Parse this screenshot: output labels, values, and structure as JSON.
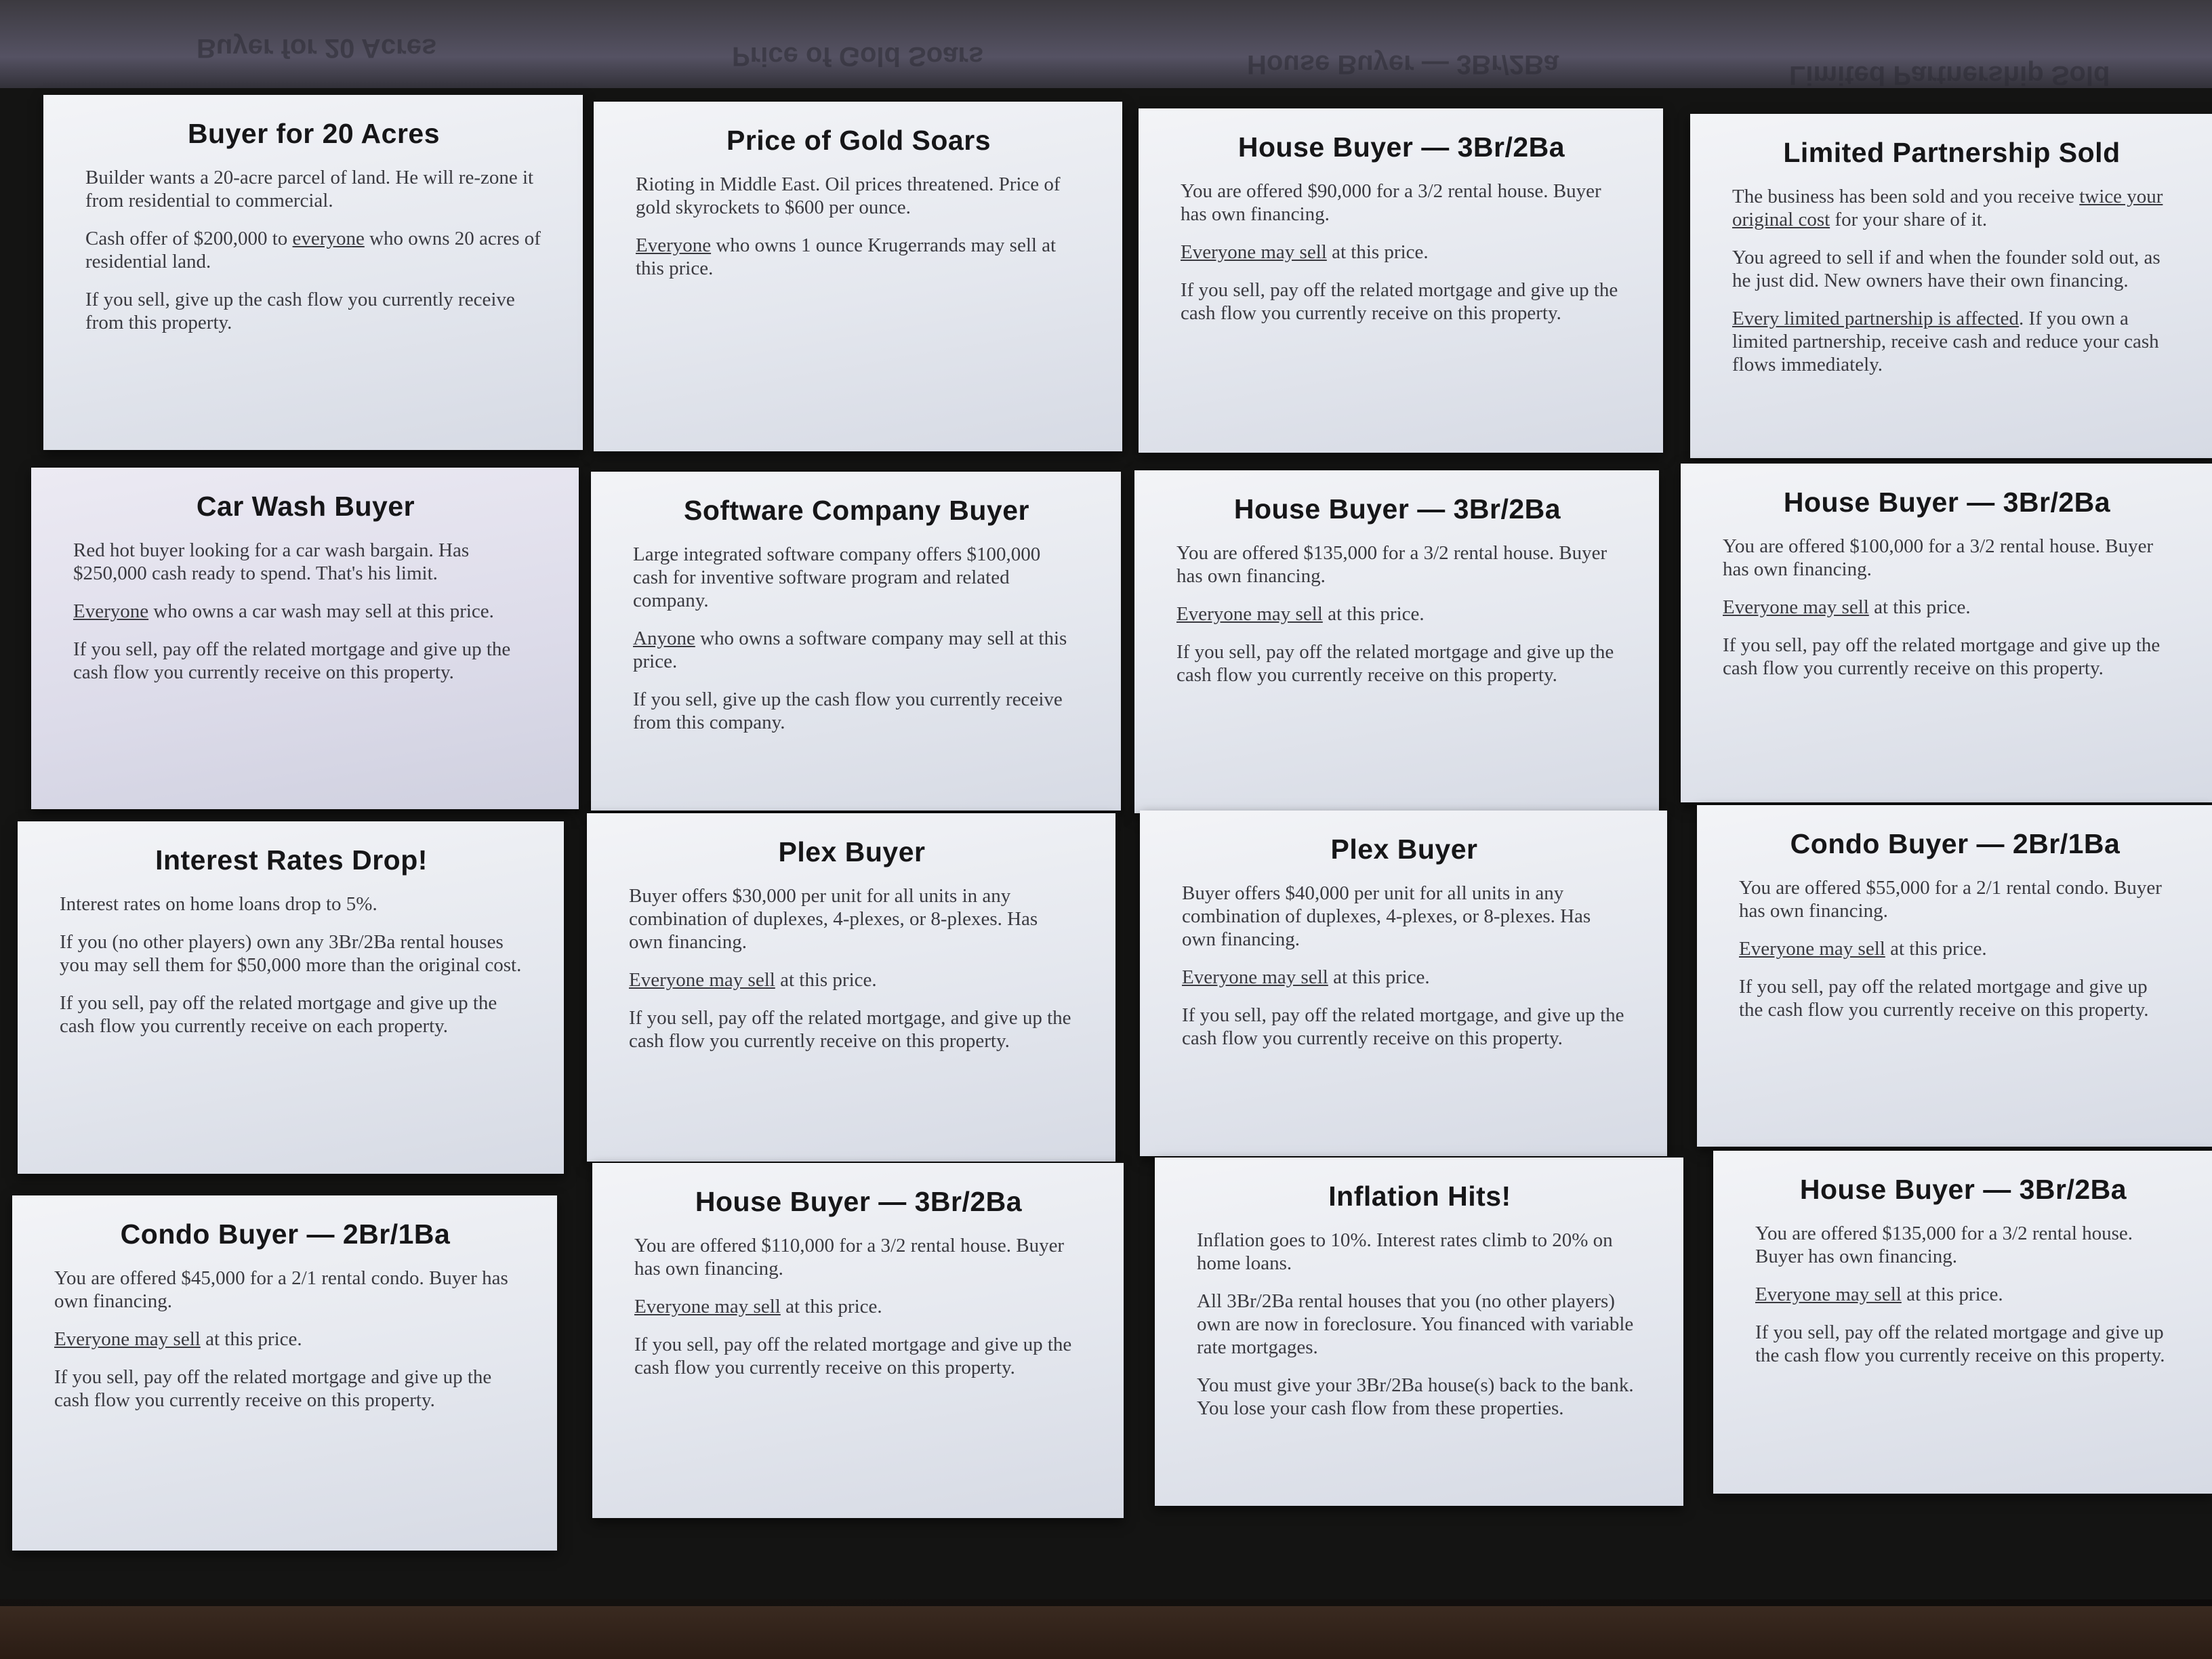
{
  "reflections": [
    "Buyer for 20 Acres",
    "Price of Gold Soars",
    "House Buyer — 3Br/2Ba",
    "Limited Partnership Sold"
  ],
  "cards": [
    {
      "title": "Buyer for 20 Acres",
      "p": [
        "Builder wants a 20-acre parcel of land. He will re-zone it from residential to commercial.",
        "Cash offer of $200,000 to ",
        "everyone",
        " who owns 20 acres of residential land.",
        "If you sell, give up the cash flow you currently receive from this property."
      ]
    },
    {
      "title": "Price of Gold Soars",
      "p": [
        "Rioting in Middle East. Oil prices threatened. Price of gold skyrockets to $600 per ounce.",
        "Everyone",
        " who owns 1 ounce Krugerrands may sell at this price."
      ]
    },
    {
      "title": "House Buyer — 3Br/2Ba",
      "p": [
        "You are offered $90,000 for a 3/2 rental house. Buyer has own financing.",
        "Everyone may sell",
        " at this price.",
        "If you sell, pay off the related mortgage and give up the cash flow you currently receive on this property."
      ]
    },
    {
      "title": "Limited Partnership Sold",
      "p": [
        "The business has been sold and you receive ",
        "twice your original cost",
        " for your share of it.",
        "You agreed to sell if and when the founder sold out, as he just did. New owners have their own financing.",
        "Every limited partnership is affected",
        ". If you own a limited partnership, receive cash and reduce your cash flows immediately."
      ]
    },
    {
      "title": "Car Wash Buyer",
      "p": [
        "Red hot buyer looking for a car wash bargain. Has $250,000 cash ready to spend. That's his limit.",
        "Everyone",
        " who owns a car wash may sell at this price.",
        "If you sell, pay off the related mortgage and give up the cash flow you currently receive on this property."
      ]
    },
    {
      "title": "Software Company Buyer",
      "p": [
        "Large integrated software company offers $100,000 cash for inventive software program and related company.",
        "Anyone",
        " who owns a software  company may sell at this price.",
        "If you sell, give up the cash flow you currently receive from this company."
      ]
    },
    {
      "title": "House Buyer — 3Br/2Ba",
      "p": [
        "You are offered $135,000 for a 3/2 rental house. Buyer has own financing.",
        "Everyone may sell",
        " at this price.",
        "If you sell, pay off the related mortgage and give up the cash flow you currently receive on this property."
      ]
    },
    {
      "title": "House Buyer — 3Br/2Ba",
      "p": [
        "You are offered $100,000 for a 3/2 rental house. Buyer has own financing.",
        "Everyone may sell",
        " at this price.",
        "If you sell, pay off the related mortgage and give up the cash flow you currently receive on this property."
      ]
    },
    {
      "title": "Interest Rates Drop!",
      "p": [
        "Interest rates on home loans drop to 5%.",
        "If you (no other players) own any 3Br/2Ba rental houses you may sell them for $50,000 more than the original cost.",
        "If you sell, pay off the related mortgage and give up the cash flow you currently receive on each property."
      ]
    },
    {
      "title": "Plex Buyer",
      "p": [
        "Buyer offers $30,000 per unit for all units in any combination of duplexes, 4-plexes, or 8-plexes. Has own financing.",
        "Everyone may sell",
        " at this price.",
        "If you sell, pay off the related mortgage, and give up the  cash flow you currently receive on this property."
      ]
    },
    {
      "title": "Plex Buyer",
      "p": [
        "Buyer offers $40,000 per unit for all units in any combination of duplexes, 4-plexes, or 8-plexes. Has own financing.",
        "Everyone may sell",
        " at this price.",
        "If you sell, pay off the related mortgage, and give up the cash flow you currently receive on this property."
      ]
    },
    {
      "title": "Condo Buyer — 2Br/1Ba",
      "p": [
        "You are offered $55,000 for a 2/1 rental condo. Buyer has own financing.",
        "Everyone may sell",
        " at this price.",
        "If you sell, pay off the related mortgage and give up the cash flow you currently receive on this property."
      ]
    },
    {
      "title": "Condo Buyer — 2Br/1Ba",
      "p": [
        "You are offered $45,000 for a 2/1 rental condo. Buyer has own financing.",
        "Everyone may sell",
        " at this price.",
        "If you sell, pay off the related mortgage and give up the cash flow you currently receive on this property."
      ]
    },
    {
      "title": "House Buyer — 3Br/2Ba",
      "p": [
        "You are offered $110,000 for a 3/2 rental house. Buyer has own financing.",
        "Everyone may sell",
        " at this price.",
        "If you sell, pay off the related mortgage and give up the cash flow you currently receive on this property."
      ]
    },
    {
      "title": "Inflation Hits!",
      "p": [
        "Inflation goes to 10%. Interest rates climb to 20% on home loans.",
        "All 3Br/2Ba rental houses that you (no other players) own are now in foreclosure. You financed with variable rate mortgages.",
        "You must give your 3Br/2Ba house(s) back to the bank. You lose your cash flow from these properties."
      ]
    },
    {
      "title": "House Buyer — 3Br/2Ba",
      "p": [
        "You are offered $135,000 for a 3/2 rental house. Buyer has own financing.",
        "Everyone may sell",
        " at this price.",
        "If you sell, pay off the related mortgage and give up the cash flow you currently receive on this property."
      ]
    }
  ]
}
